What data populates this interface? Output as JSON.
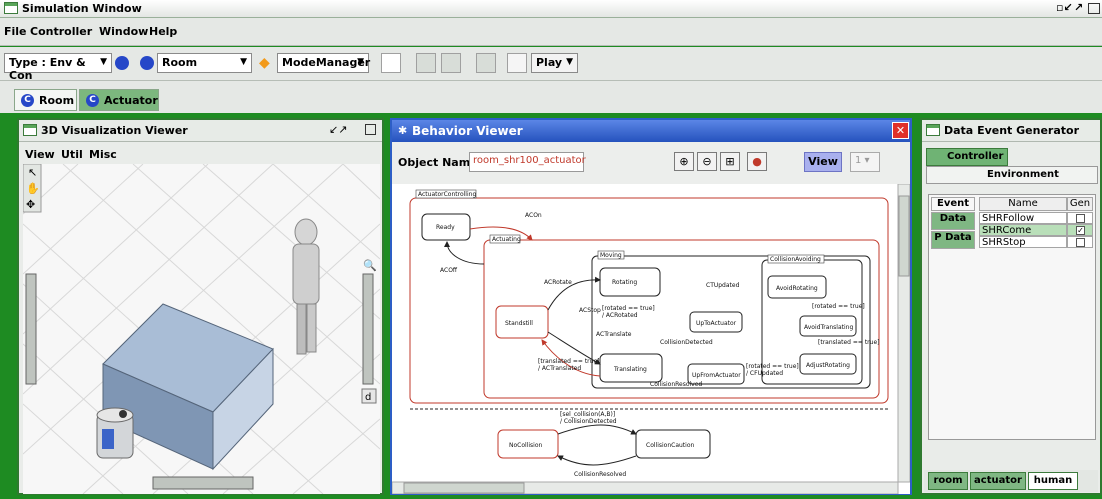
{
  "window": {
    "title": "Simulation Window"
  },
  "menu": [
    "File",
    "Controller",
    "Window",
    "Help"
  ],
  "toolbar": {
    "type_label": "Type :",
    "type_value": "Env & Con",
    "room_value": "Room",
    "mode_value": "ModeManager",
    "play_label": "Play"
  },
  "tabs": [
    "Room",
    "Actuator"
  ],
  "viz": {
    "title": "3D Visualization Viewer",
    "menu": [
      "View",
      "Util",
      "Misc"
    ],
    "side_label": "d"
  },
  "behavior": {
    "title": "Behavior Viewer",
    "object_label": "Object Name :",
    "object_value": "room_shr100_actuator",
    "view_label": "View",
    "view_select": "1"
  },
  "diagram": {
    "outer": "ActuatorControlling",
    "ready": "Ready",
    "acon": "ACOn",
    "actuating": "Actuating",
    "acoff": "ACOff",
    "moving": "Moving",
    "acrotate": "ACRotate",
    "rotating": "Rotating",
    "ctupdated": "CTUpdated",
    "collision_avoiding": "CollisionAvoiding",
    "avoid_rotating": "AvoidRotating",
    "rotated_true_1": "[rotated == true]",
    "avoid_translating": "AvoidTranslating",
    "rotated_true_2": "[rotated == true]",
    "ac_rotated": "/ ACRotated",
    "acstop": "ACStop",
    "standstill": "Standstill",
    "up_to_actuator": "UpToActuator",
    "actranslate": "ACTranslate",
    "collision_detected": "CollisionDetected",
    "translated_true_1": "[translated == true]",
    "translated_true_2": "[translated == true]",
    "ac_translated": "/ ACTranslated",
    "translating": "Translating",
    "up_from_actuator": "UpFromActuator",
    "rotated_true_3": "[rotated == true]",
    "cfupdated": "/ CFUpdated",
    "adjust_rotating": "AdjustRotating",
    "collision_resolved": "CollisionResolved",
    "guard_collision": "[sel_collision(A,B)]",
    "guard_collision_action": "/ CollisionDetected",
    "no_collision": "NoCollision",
    "collision_caution": "CollisionCaution",
    "collision_resolved_2": "CollisionResolved"
  },
  "generator": {
    "title": "Data Event Generator",
    "controller_tab": "Controller",
    "environment_tab": "Environment",
    "side": [
      "Event",
      "Data",
      "P Data"
    ],
    "headers": [
      "Name",
      "Gen"
    ],
    "rows": [
      {
        "name": "SHRFollow",
        "checked": false
      },
      {
        "name": "SHRCome",
        "checked": true
      },
      {
        "name": "SHRStop",
        "checked": false
      }
    ],
    "bottom_tabs": [
      "room",
      "actuator",
      "human"
    ]
  },
  "colors": {
    "frame_green": "#1e8b22",
    "behavior_blue": "#2d5ec6",
    "state_red": "#c0392b",
    "accent_red": "#e0302a"
  }
}
